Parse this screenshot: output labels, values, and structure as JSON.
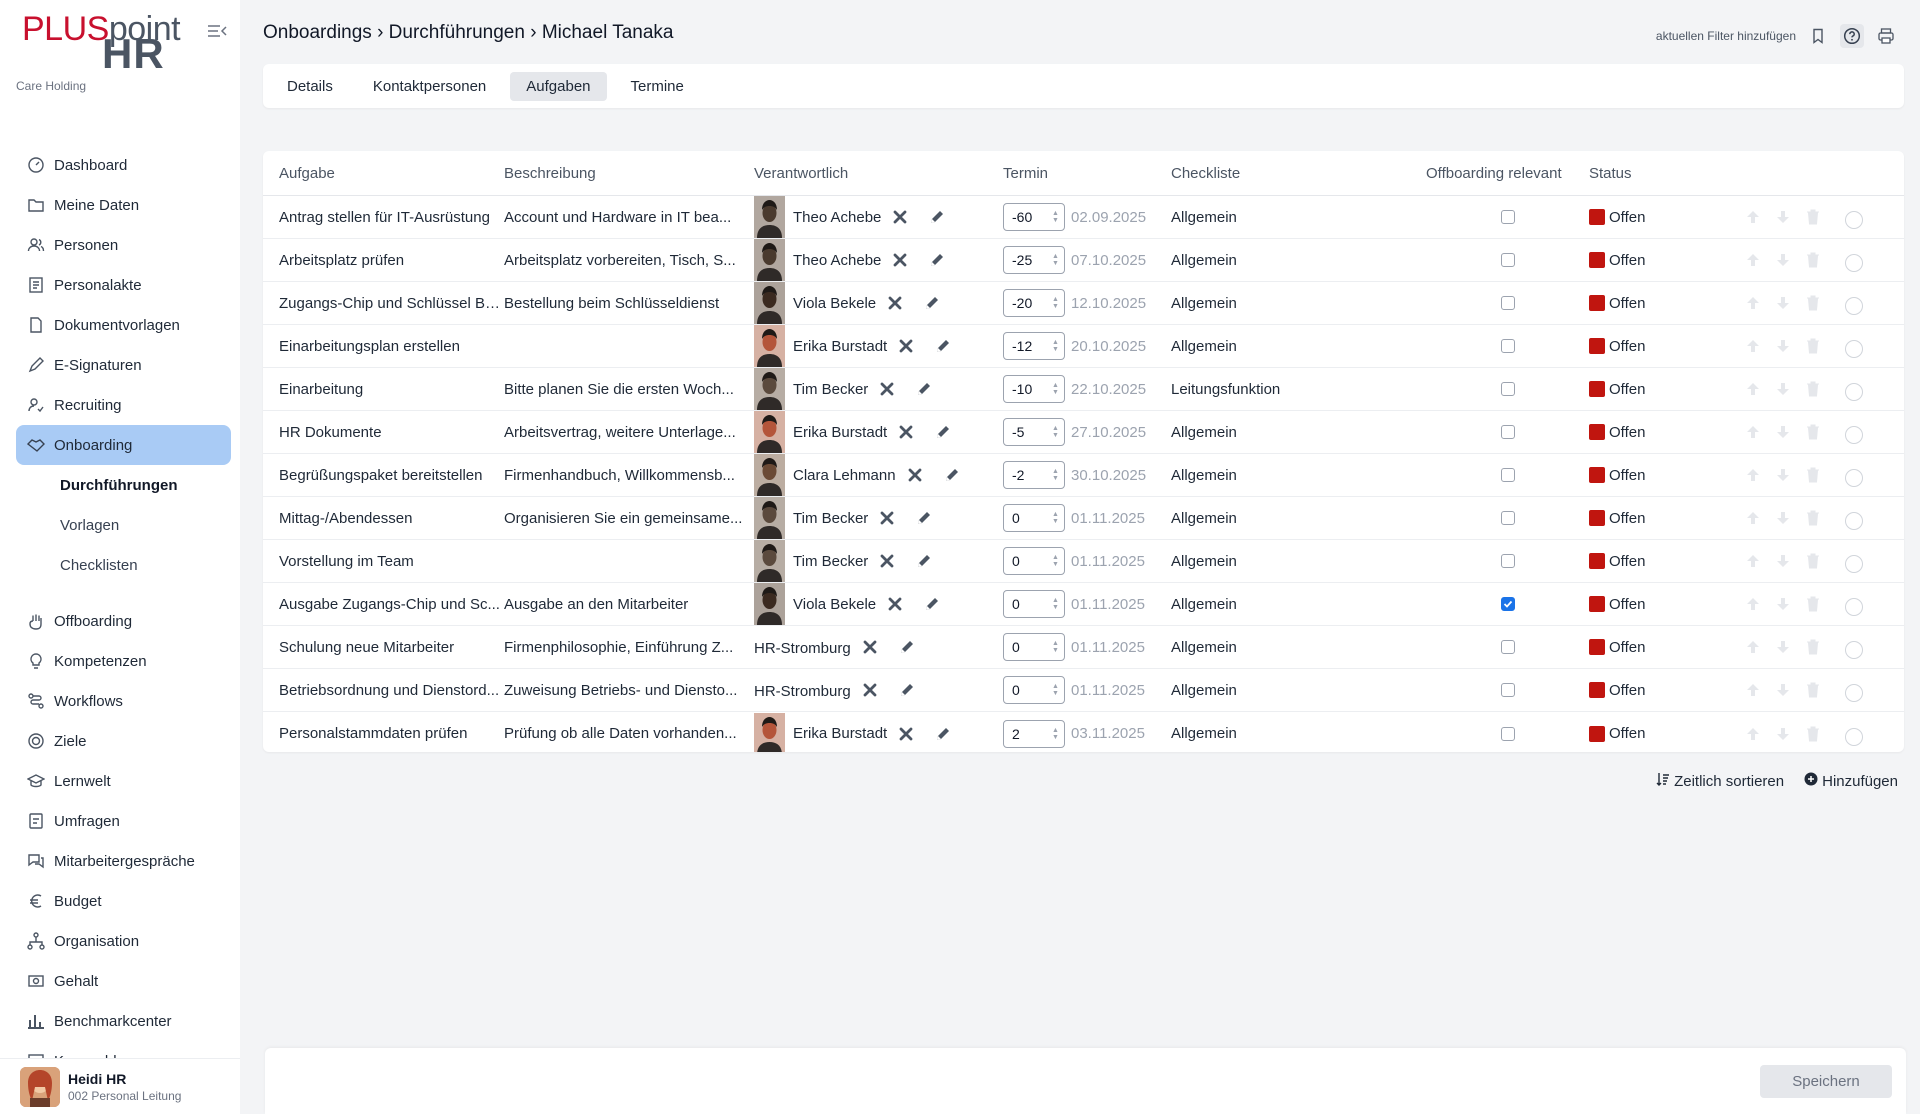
{
  "brand": {
    "logo_plus": "PLUS",
    "logo_point": "point",
    "logo_hr": "HR",
    "org": "Care Holding"
  },
  "breadcrumb": "Onboardings › Durchführungen › Michael Tanaka",
  "top": {
    "filter_label": "aktuellen Filter hinzufügen"
  },
  "nav": {
    "items": [
      {
        "label": "Dashboard",
        "icon": "dashboard-icon"
      },
      {
        "label": "Meine Daten",
        "icon": "folder-icon"
      },
      {
        "label": "Personen",
        "icon": "users-icon"
      },
      {
        "label": "Personalakte",
        "icon": "file-icon"
      },
      {
        "label": "Dokumentvorlagen",
        "icon": "document-icon"
      },
      {
        "label": "E-Signaturen",
        "icon": "pen-icon"
      },
      {
        "label": "Recruiting",
        "icon": "recruiting-icon"
      },
      {
        "label": "Onboarding",
        "icon": "handshake-icon"
      }
    ],
    "sub": [
      "Durchführungen",
      "Vorlagen",
      "Checklisten"
    ],
    "items2": [
      {
        "label": "Offboarding",
        "icon": "hand-icon"
      },
      {
        "label": "Kompetenzen",
        "icon": "bulb-icon"
      },
      {
        "label": "Workflows",
        "icon": "workflow-icon"
      },
      {
        "label": "Ziele",
        "icon": "target-icon"
      },
      {
        "label": "Lernwelt",
        "icon": "graduation-icon"
      },
      {
        "label": "Umfragen",
        "icon": "survey-icon"
      },
      {
        "label": "Mitarbeitergespräche",
        "icon": "chat-icon"
      },
      {
        "label": "Budget",
        "icon": "euro-icon"
      },
      {
        "label": "Organisation",
        "icon": "org-icon"
      },
      {
        "label": "Gehalt",
        "icon": "money-icon"
      },
      {
        "label": "Benchmarkcenter",
        "icon": "bar-chart-icon"
      },
      {
        "label": "Kennzahlen",
        "icon": "kpi-icon"
      }
    ]
  },
  "user": {
    "name": "Heidi HR",
    "role": "002 Personal Leitung"
  },
  "tabs": [
    "Details",
    "Kontaktpersonen",
    "Aufgaben",
    "Termine"
  ],
  "table": {
    "headers": {
      "task": "Aufgabe",
      "desc": "Beschreibung",
      "resp": "Verantwortlich",
      "term": "Termin",
      "check": "Checkliste",
      "off": "Offboarding relevant",
      "status": "Status"
    },
    "rows": [
      {
        "task": "Antrag stellen für IT-Ausrüstung",
        "desc": "Account und Hardware in IT bea...",
        "resp": "Theo Achebe",
        "avatar": "#4a3a2e",
        "offset": "-60",
        "date": "02.09.2025",
        "check": "Allgemein",
        "off": false,
        "status": "Offen"
      },
      {
        "task": "Arbeitsplatz prüfen",
        "desc": "Arbeitsplatz vorbereiten, Tisch, S...",
        "resp": "Theo Achebe",
        "avatar": "#4a3a2e",
        "offset": "-25",
        "date": "07.10.2025",
        "check": "Allgemein",
        "off": false,
        "status": "Offen"
      },
      {
        "task": "Zugangs-Chip und Schlüssel Be...",
        "desc": "Bestellung beim Schlüsseldienst",
        "resp": "Viola Bekele",
        "avatar": "#3b2a20",
        "offset": "-20",
        "date": "12.10.2025",
        "check": "Allgemein",
        "off": false,
        "status": "Offen"
      },
      {
        "task": "Einarbeitungsplan erstellen",
        "desc": "",
        "resp": "Erika Burstadt",
        "avatar": "#b4553a",
        "offset": "-12",
        "date": "20.10.2025",
        "check": "Allgemein",
        "off": false,
        "status": "Offen"
      },
      {
        "task": "Einarbeitung",
        "desc": "Bitte planen Sie die ersten Woch...",
        "resp": "Tim Becker",
        "avatar": "#5b4a3d",
        "offset": "-10",
        "date": "22.10.2025",
        "check": "Leitungsfunktion",
        "off": false,
        "status": "Offen"
      },
      {
        "task": "HR Dokumente",
        "desc": "Arbeitsvertrag, weitere Unterlage...",
        "resp": "Erika Burstadt",
        "avatar": "#b4553a",
        "offset": "-5",
        "date": "27.10.2025",
        "check": "Allgemein",
        "off": false,
        "status": "Offen"
      },
      {
        "task": "Begrüßungspaket bereitstellen",
        "desc": "Firmenhandbuch, Willkommensb...",
        "resp": "Clara Lehmann",
        "avatar": "#6b4a35",
        "offset": "-2",
        "date": "30.10.2025",
        "check": "Allgemein",
        "off": false,
        "status": "Offen"
      },
      {
        "task": "Mittag-/Abendessen",
        "desc": "Organisieren Sie ein gemeinsame...",
        "resp": "Tim Becker",
        "avatar": "#5b4a3d",
        "offset": "0",
        "date": "01.11.2025",
        "check": "Allgemein",
        "off": false,
        "status": "Offen"
      },
      {
        "task": "Vorstellung im Team",
        "desc": "",
        "resp": "Tim Becker",
        "avatar": "#5b4a3d",
        "offset": "0",
        "date": "01.11.2025",
        "check": "Allgemein",
        "off": false,
        "status": "Offen"
      },
      {
        "task": "Ausgabe Zugangs-Chip und Sc...",
        "desc": "Ausgabe an den Mitarbeiter",
        "resp": "Viola Bekele",
        "avatar": "#3b2a20",
        "offset": "0",
        "date": "01.11.2025",
        "check": "Allgemein",
        "off": true,
        "status": "Offen"
      },
      {
        "task": "Schulung neue Mitarbeiter",
        "desc": "Firmenphilosophie, Einführung Z...",
        "resp": "HR-Stromburg",
        "avatar": "",
        "offset": "0",
        "date": "01.11.2025",
        "check": "Allgemein",
        "off": false,
        "status": "Offen"
      },
      {
        "task": "Betriebsordnung und Dienstord...",
        "desc": "Zuweisung Betriebs- und Diensto...",
        "resp": "HR-Stromburg",
        "avatar": "",
        "offset": "0",
        "date": "01.11.2025",
        "check": "Allgemein",
        "off": false,
        "status": "Offen"
      },
      {
        "task": "Personalstammdaten prüfen",
        "desc": "Prüfung ob alle Daten vorhanden...",
        "resp": "Erika Burstadt",
        "avatar": "#b4553a",
        "offset": "2",
        "date": "03.11.2025",
        "check": "Allgemein",
        "off": false,
        "status": "Offen"
      }
    ]
  },
  "actions": {
    "sort": "Zeitlich sortieren",
    "add": "Hinzufügen"
  },
  "footer": {
    "save": "Speichern"
  },
  "colors": {
    "accent": "#a9cbf5",
    "status_red": "#c0150f",
    "brand_red": "#c8102e",
    "checkbox_blue": "#1a73e8"
  }
}
